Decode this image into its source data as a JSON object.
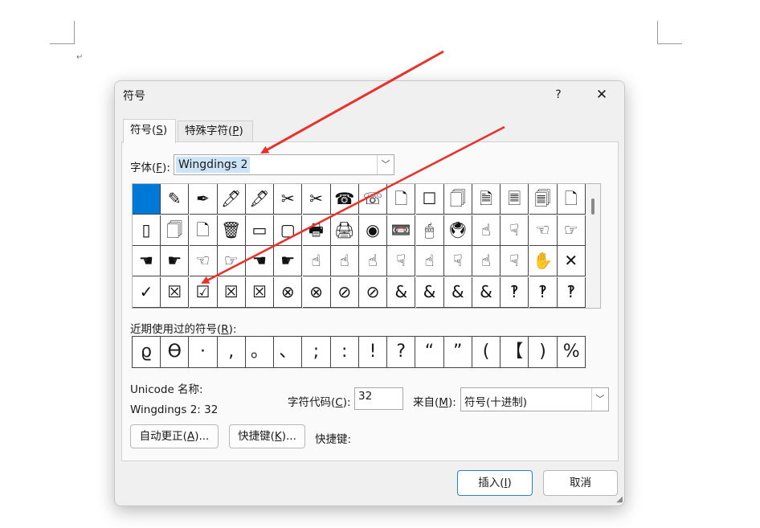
{
  "dialog": {
    "title": "符号",
    "help": "?",
    "close": "✕",
    "para_mark": "↵"
  },
  "tabs": {
    "symbols": {
      "pre": "符号(",
      "key": "S",
      "post": ")"
    },
    "special": {
      "pre": "特殊字符(",
      "key": "P",
      "post": ")"
    }
  },
  "font": {
    "label_pre": "字体(",
    "label_key": "F",
    "label_post": "):",
    "value": "Wingdings 2",
    "arrow": "﹀"
  },
  "symbols_grid": [
    [
      "",
      "✎",
      "✒",
      "🖊",
      "🖋",
      "✂",
      "✂",
      "☎",
      "☏",
      "🗋",
      "☐",
      "🗍",
      "🗎",
      "🗏",
      "🗐",
      "🗋"
    ],
    [
      "▯",
      "🗍",
      "🗋",
      "🗑",
      "▭",
      "▢",
      "🖶",
      "🖨",
      "◉",
      "📼",
      "🖱",
      "🖲",
      "☝",
      "☟",
      "☜",
      "☞"
    ],
    [
      "☚",
      "☛",
      "☜",
      "☞",
      "☚",
      "☛",
      "☝",
      "☝",
      "☝",
      "☟",
      "☝",
      "☟",
      "☝",
      "☟",
      "✋",
      "✕"
    ],
    [
      "✓",
      "☒",
      "☑",
      "☒",
      "☒",
      "⊗",
      "⊗",
      "⊘",
      "⊘",
      "&",
      "&",
      "&",
      "&",
      "‽",
      "‽",
      "‽"
    ]
  ],
  "recent": {
    "label_pre": "近期使用过的符号(",
    "label_key": "R",
    "label_post": "):",
    "chars": [
      "ϱ",
      "ϴ",
      "·",
      ",",
      "。",
      "、",
      ";",
      ":",
      "!",
      "?",
      "“",
      "”",
      "(",
      "【",
      ")",
      "%"
    ]
  },
  "unicode": {
    "name_label": "Unicode 名称:",
    "name_value": "Wingdings 2: 32"
  },
  "char_code": {
    "label_pre": "字符代码(",
    "label_key": "C",
    "label_post": "):",
    "value": "32"
  },
  "from": {
    "label_pre": "来自(",
    "label_key": "M",
    "label_post": "):",
    "value": "符号(十进制)",
    "arrow": "﹀"
  },
  "buttons": {
    "autocorrect": {
      "pre": "自动更正(",
      "key": "A",
      "post": ")..."
    },
    "shortcut_key": {
      "pre": "快捷键(",
      "key": "K",
      "post": ")..."
    },
    "shortcut_label": "快捷键:",
    "insert": {
      "pre": "插入(",
      "key": "I",
      "post": ")"
    },
    "cancel": "取消"
  },
  "colors": {
    "selection": "#0078d7",
    "font_highlight": "#cce4f7",
    "annotation_arrow": "#e8312a",
    "insert_border": "#2b7fd2"
  }
}
